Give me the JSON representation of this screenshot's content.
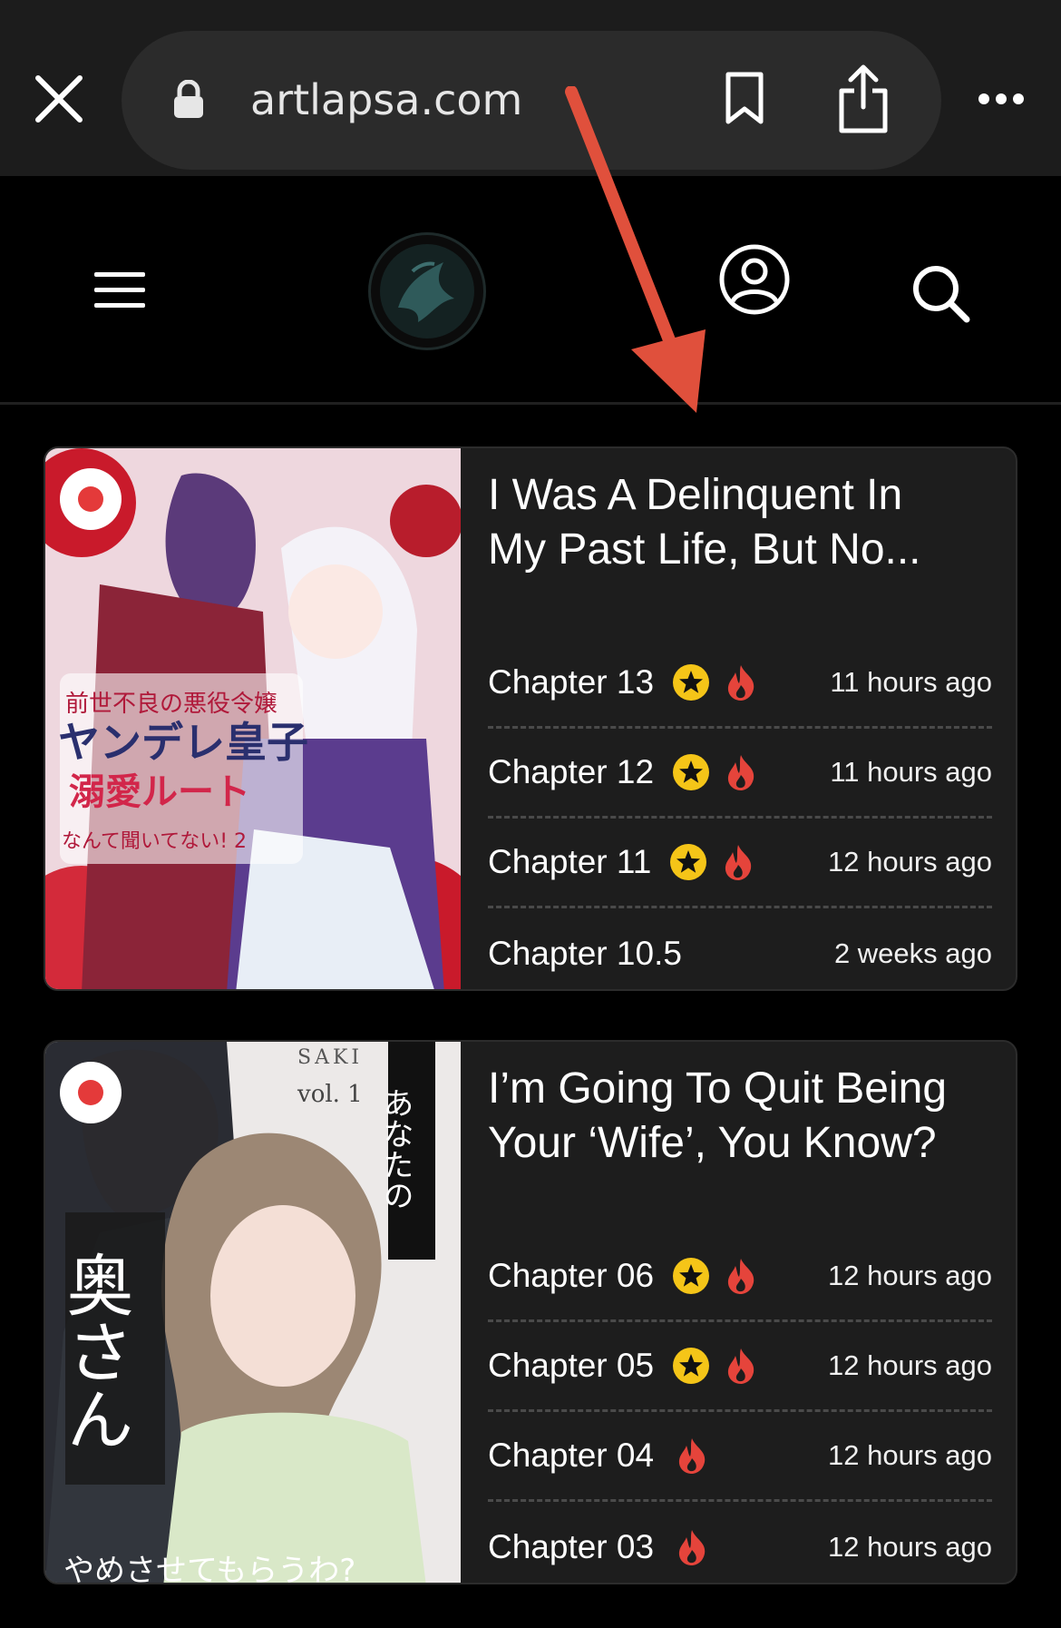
{
  "browser": {
    "url": "artlapsa.com"
  },
  "colors": {
    "accent_fire": "#e5443b",
    "star_fill": "#f5c518",
    "arrow": "#e0503c",
    "card_bg": "#1d1d1d"
  },
  "cards": [
    {
      "title": "I Was A Delinquent In\nMy Past Life, But No...",
      "cover_text": [
        "前世不良の悪役令嬢",
        "ヤンデレ皇子",
        "溺愛ルート",
        "なんて聞いてない! 2"
      ],
      "chapters": [
        {
          "label": "Chapter 13",
          "star": true,
          "fire": true,
          "time": "11 hours ago"
        },
        {
          "label": "Chapter 12",
          "star": true,
          "fire": true,
          "time": "11 hours ago"
        },
        {
          "label": "Chapter 11",
          "star": true,
          "fire": true,
          "time": "12 hours ago"
        },
        {
          "label": "Chapter 10.5",
          "star": false,
          "fire": false,
          "time": "2 weeks ago"
        }
      ]
    },
    {
      "title": "I’m Going To Quit Being\nYour ‘Wife’, You Know?",
      "cover_text": [
        "SAKI",
        "vol. 1",
        "あなたの",
        "奥さん",
        "やめさせてもらうわ?"
      ],
      "chapters": [
        {
          "label": "Chapter 06",
          "star": true,
          "fire": true,
          "time": "12 hours ago"
        },
        {
          "label": "Chapter 05",
          "star": true,
          "fire": true,
          "time": "12 hours ago"
        },
        {
          "label": "Chapter 04",
          "star": false,
          "fire": true,
          "time": "12 hours ago"
        },
        {
          "label": "Chapter 03",
          "star": false,
          "fire": true,
          "time": "12 hours ago"
        }
      ]
    }
  ]
}
